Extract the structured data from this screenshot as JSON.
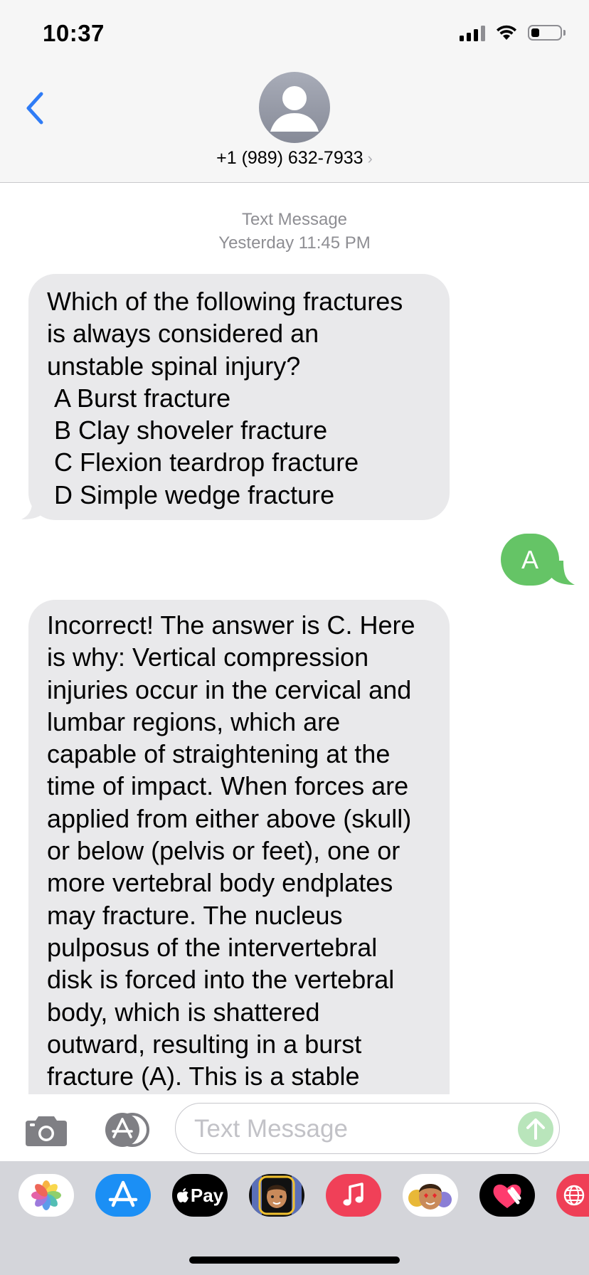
{
  "status_bar": {
    "time": "10:37"
  },
  "contact": {
    "number": "+1 (989) 632-7933",
    "chevron": "›"
  },
  "thread": {
    "service_label": "Text Message",
    "timestamp": "Yesterday 11:45 PM",
    "messages": [
      {
        "direction": "incoming",
        "text": "Which of the following fractures\nis always considered an\nunstable spinal injury?\n A Burst fracture\n B Clay shoveler fracture\n C Flexion teardrop fracture\n D Simple wedge fracture"
      },
      {
        "direction": "outgoing",
        "text": "A"
      },
      {
        "direction": "incoming",
        "text": "Incorrect! The answer is C. Here\nis why: Vertical compression\ninjuries occur in the cervical and\nlumbar regions, which are\ncapable of straightening at the\ntime of impact. When forces are\napplied from either above (skull)\nor below (pelvis or feet), one or\nmore vertebral body endplates\nmay fracture. The nucleus\npulposus of the intervertebral\ndisk is forced into the vertebral\nbody, which is shattered\noutward, resulting in a burst\nfracture (A). This is a stable"
      }
    ]
  },
  "composer": {
    "placeholder": "Text Message"
  },
  "app_drawer": {
    "apps": [
      {
        "name": "photos-app",
        "icon": "photos-icon"
      },
      {
        "name": "app-store-app",
        "icon": "app-store-icon"
      },
      {
        "name": "apple-pay-app",
        "label": "Pay",
        "icon": "apple-pay-icon"
      },
      {
        "name": "memoji-app",
        "icon": "memoji-icon"
      },
      {
        "name": "music-app",
        "icon": "music-icon"
      },
      {
        "name": "animoji-app",
        "icon": "animoji-icon"
      },
      {
        "name": "digital-touch-app",
        "icon": "heart-icon"
      },
      {
        "name": "web-images-app",
        "icon": "globe-icon"
      }
    ]
  },
  "colors": {
    "accent_blue": "#2f7cf6",
    "incoming_bubble": "#e9e9eb",
    "outgoing_bubble": "#65c466",
    "header_bg": "#f6f6f6",
    "drawer_bg": "#d4d5da"
  }
}
